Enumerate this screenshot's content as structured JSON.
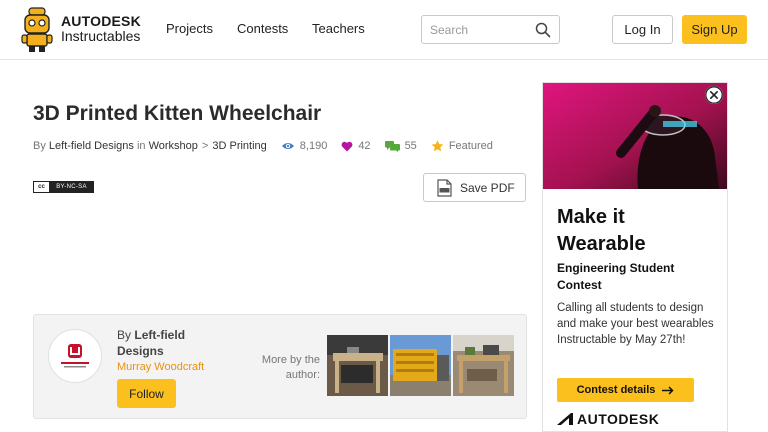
{
  "header": {
    "brand_top": "AUTODESK",
    "brand_bottom": "Instructables",
    "nav": [
      "Projects",
      "Contests",
      "Teachers"
    ],
    "search_placeholder": "Search",
    "login_label": "Log In",
    "signup_label": "Sign Up",
    "accent_color": "#fbbf1e"
  },
  "article": {
    "title": "3D Printed Kitten Wheelchair",
    "by_label": "By",
    "author": "Left-field Designs",
    "in_label": "in",
    "category": "Workshop",
    "breadcrumb_sep": ">",
    "subcategory": "3D Printing",
    "views": "8,190",
    "favorites": "42",
    "comments": "55",
    "featured_label": "Featured",
    "license_cc": "cc",
    "license_terms": "BY-NC-SA",
    "save_pdf_label": "Save PDF"
  },
  "author_card": {
    "by_label": "By",
    "name": "Left-field Designs",
    "subname": "Murray Woodcraft",
    "follow_label": "Follow",
    "more_by_label": "More by the author:"
  },
  "ad": {
    "headline": "Make it Wearable",
    "subhead": "Engineering Student Contest",
    "body": "Calling all students to design and make your best wearables Instructable by May 27th!",
    "cta_label": "Contest details",
    "brand": "AUTODESK"
  },
  "icons": {
    "views": "eye-icon",
    "favorites": "heart-icon",
    "comments": "comments-icon",
    "featured": "star-icon",
    "pdf": "pdf-file-icon",
    "search": "search-icon",
    "close": "close-icon",
    "cta_arrow": "arrow-right-icon"
  },
  "colors": {
    "views": "#3a7bc8",
    "favorites": "#b5179e",
    "comments": "#56a83a",
    "featured": "#f4b421",
    "subname": "#e8920f"
  }
}
